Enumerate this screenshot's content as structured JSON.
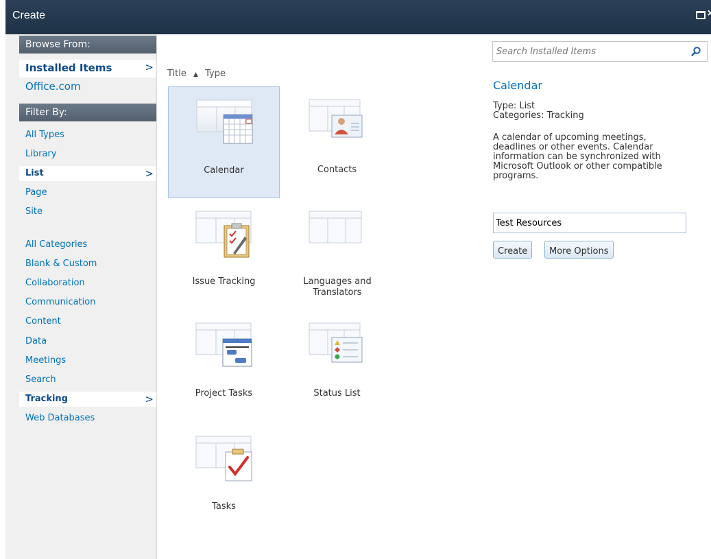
{
  "window": {
    "title": "Create",
    "maximize_icon": "maximize-icon",
    "close_label": "×"
  },
  "sidebar": {
    "browse_header": "Browse From:",
    "browse_items": [
      {
        "label": "Installed Items",
        "selected": true
      },
      {
        "label": "Office.com",
        "selected": false
      }
    ],
    "filter_header": "Filter By:",
    "type_items": [
      {
        "label": "All Types",
        "selected": false
      },
      {
        "label": "Library",
        "selected": false
      },
      {
        "label": "List",
        "selected": true
      },
      {
        "label": "Page",
        "selected": false
      },
      {
        "label": "Site",
        "selected": false
      }
    ],
    "category_items": [
      {
        "label": "All Categories",
        "selected": false
      },
      {
        "label": "Blank & Custom",
        "selected": false
      },
      {
        "label": "Collaboration",
        "selected": false
      },
      {
        "label": "Communication",
        "selected": false
      },
      {
        "label": "Content",
        "selected": false
      },
      {
        "label": "Data",
        "selected": false
      },
      {
        "label": "Meetings",
        "selected": false
      },
      {
        "label": "Search",
        "selected": false
      },
      {
        "label": "Tracking",
        "selected": true
      },
      {
        "label": "Web Databases",
        "selected": false
      }
    ],
    "chevron": ">"
  },
  "sort": {
    "title_label": "Title",
    "sort_arrow": "▲",
    "type_label": "Type"
  },
  "items": [
    {
      "label": "Calendar",
      "icon": "calendar-icon",
      "selected": true
    },
    {
      "label": "Contacts",
      "icon": "contacts-icon",
      "selected": false
    },
    {
      "label": "Issue Tracking",
      "icon": "issue-tracking-icon",
      "selected": false
    },
    {
      "label": "Languages and Translators",
      "icon": "languages-icon",
      "selected": false
    },
    {
      "label": "Project Tasks",
      "icon": "project-tasks-icon",
      "selected": false
    },
    {
      "label": "Status List",
      "icon": "status-list-icon",
      "selected": false
    },
    {
      "label": "Tasks",
      "icon": "tasks-icon",
      "selected": false
    }
  ],
  "search": {
    "placeholder": "Search Installed Items"
  },
  "detail": {
    "title": "Calendar",
    "type_line": "Type: List",
    "categories_line": "Categories: Tracking",
    "description": "A calendar of upcoming meetings, deadlines or other events.  Calendar information can be synchronized with Microsoft Outlook or other compatible programs.",
    "name_value": "Test Resources",
    "create_label": "Create",
    "more_options_label": "More Options"
  },
  "colors": {
    "titlebar": "#21374c",
    "nav_header": "#5d6d7c",
    "link": "#0072bc",
    "selected_tile": "#dfe8f5"
  }
}
